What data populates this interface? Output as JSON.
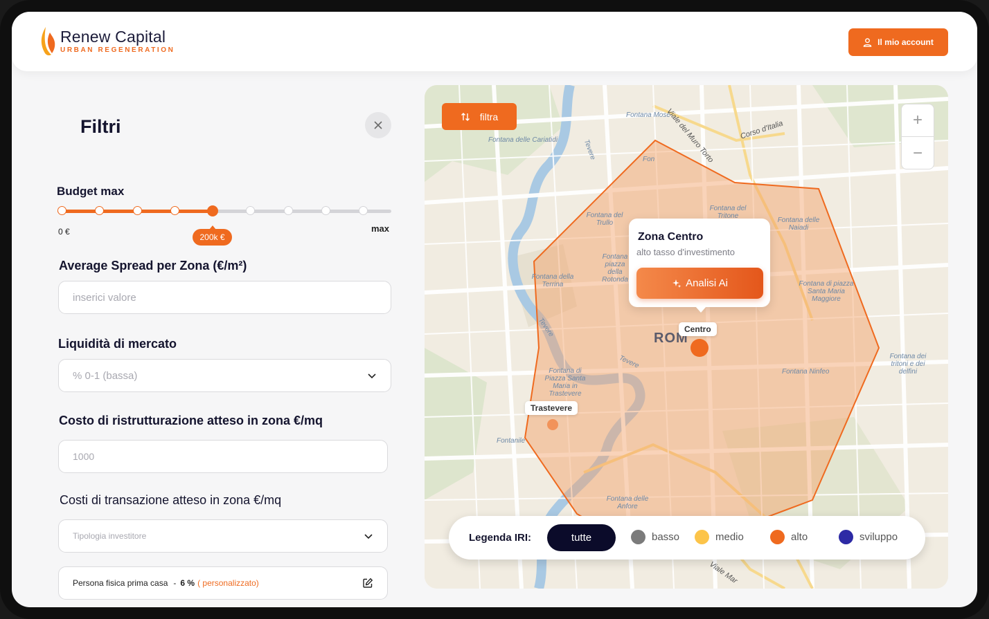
{
  "brand": {
    "name": "Renew Capital",
    "tagline": "URBAN REGENERATION",
    "accent_color": "#ef6a1f",
    "dark_color": "#14142e"
  },
  "header": {
    "account_button": "Il mio account",
    "account_icon": "user-icon"
  },
  "filters": {
    "title": "Filtri",
    "close_icon": "close-icon",
    "budget": {
      "label": "Budget max",
      "min_label": "0 €",
      "max_label": "max",
      "value_label": "200k €",
      "steps": 9,
      "selected_step": 4
    },
    "average_spread": {
      "label": "Average Spread per Zona (€/m²)",
      "placeholder": "inserici valore"
    },
    "liquidity": {
      "label": "Liquidità di mercato",
      "selected": "% 0-1 (bassa)"
    },
    "renovation_cost": {
      "label": "Costo di ristrutturazione atteso in zona €/mq",
      "placeholder": "1000"
    },
    "transaction_cost": {
      "label": "Costi di transazione atteso in zona €/mq",
      "selected": "Tipologia investitore"
    },
    "investor_profile": {
      "type": "Persona fisica prima casa",
      "separator": "-",
      "percent": "6 %",
      "mode": "( personalizzato)",
      "edit_icon": "edit-icon"
    }
  },
  "map": {
    "filter_button": "filtra",
    "filter_icon": "sort-arrows-icon",
    "zoom_in": "+",
    "zoom_out": "−",
    "city_label": "ROM",
    "street_labels": {
      "corso_italia": "Corso d'Italia",
      "viale_muro_torto": "Viale del Muro Torto",
      "fontana_cariatidi": "Fontana delle Cariatidi",
      "fontana_mose": "Fontana Mosè",
      "fontana_trullo": "Fontana del Trullo",
      "fontana_tritone": "Fontana del Tritone",
      "fontana_naiadi": "Fontana delle Naiadi",
      "fontana_terrina": "Fontana della Terrina",
      "fontana_rotonda": "Fontana piazza della Rotonda",
      "fontana_santa_maria_maggiore": "Fontana di piazza Santa Maria Maggiore",
      "fontana_santa_maria_trastevere": "Fontana di Piazza Santa Maria in Trastevere",
      "fontana_ninfeo": "Fontana Ninfeo",
      "fontana_tritoni_delfini": "Fontana dei tritoni e dei delfini",
      "fontana_anfore": "Fontana delle Anfore",
      "fontanile": "Fontanile",
      "tevere_north": "Tevere",
      "tevere_west": "Tevere",
      "tevere_south": "Tevere",
      "viale_marconi": "Viale Mar",
      "fon": "Fon"
    },
    "popup": {
      "title": "Zona Centro",
      "subtitle": "alto tasso d'investimento",
      "button": "Analisi Ai",
      "button_icon": "sparkle-icon"
    },
    "pins": {
      "centro": "Centro",
      "trastevere": "Trastevere"
    },
    "legend": {
      "title": "Legenda IRI:",
      "all": "tutte",
      "items": [
        {
          "label": "basso",
          "color": "#7b7b7b"
        },
        {
          "label": "medio",
          "color": "#fcc44a"
        },
        {
          "label": "alto",
          "color": "#ef6a1f"
        },
        {
          "label": "sviluppo",
          "color": "#2d2aa5"
        }
      ]
    }
  }
}
